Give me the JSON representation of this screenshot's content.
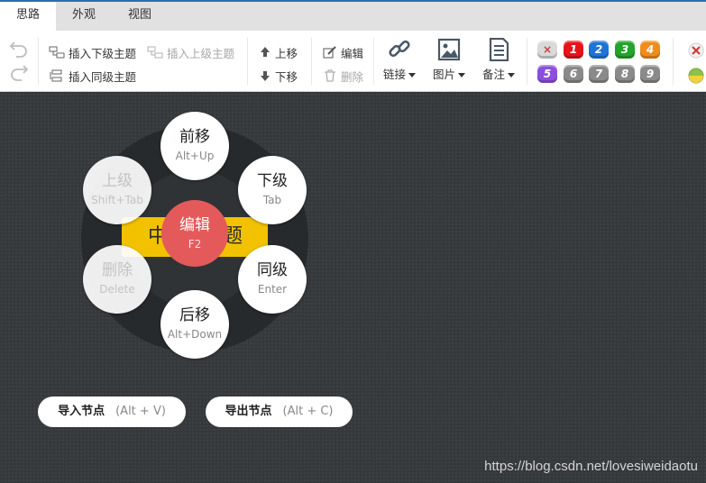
{
  "tabs": [
    {
      "label": "思路",
      "active": true
    },
    {
      "label": "外观",
      "active": false
    },
    {
      "label": "视图",
      "active": false
    }
  ],
  "toolbar": {
    "insert_child": "插入下级主题",
    "insert_parent": "插入上级主题",
    "insert_sibling": "插入同级主题",
    "move_up": "上移",
    "move_down": "下移",
    "edit": "编辑",
    "delete": "删除",
    "link": "链接",
    "image": "图片",
    "note": "备注",
    "priorities": [
      "×",
      "1",
      "2",
      "3",
      "4",
      "5",
      "6",
      "7",
      "8",
      "9"
    ],
    "priority_colors": [
      "#d9d9d9",
      "#e6141a",
      "#1e74d6",
      "#23a42a",
      "#f08c1a",
      "#8c4fe0",
      "#8a8a8a",
      "#8a8a8a",
      "#8a8a8a",
      "#8a8a8a"
    ]
  },
  "canvas": {
    "root_left": "中",
    "root_right": "题",
    "hotbox": {
      "up": {
        "label": "前移",
        "key": "Alt+Up"
      },
      "parent": {
        "label": "上级",
        "key": "Shift+Tab"
      },
      "child": {
        "label": "下级",
        "key": "Tab"
      },
      "edit": {
        "label": "编辑",
        "key": "F2"
      },
      "delete": {
        "label": "删除",
        "key": "Delete"
      },
      "sibling": {
        "label": "同级",
        "key": "Enter"
      },
      "down": {
        "label": "后移",
        "key": "Alt+Down"
      }
    },
    "import_btn": {
      "label": "导入节点",
      "shortcut": "(Alt + V)"
    },
    "export_btn": {
      "label": "导出节点",
      "shortcut": "(Alt + C)"
    }
  },
  "watermark": "https://blog.csdn.net/lovesiweidaotu"
}
